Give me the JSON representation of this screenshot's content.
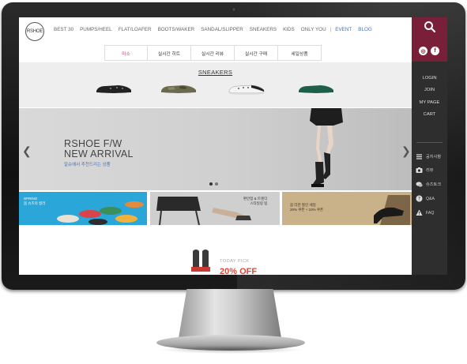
{
  "header": {
    "logo_text": "RSHOE",
    "nav": [
      "BEST 30",
      "PUMPS/HEEL",
      "FLAT/LOAFER",
      "BOOTS/WAKER",
      "SANDAL/SLIPPER",
      "SNEAKERS",
      "KIDS",
      "ONLY YOU"
    ],
    "nav_accent": [
      "EVENT",
      "BLOG"
    ],
    "separator": "|"
  },
  "subtabs": [
    "미소",
    "실시간 히트",
    "실시간 리뷰",
    "실시간 구매",
    "세일상품"
  ],
  "sneakers": {
    "title": "SNEAKERS"
  },
  "banner": {
    "title_line1": "RSHOE  F/W",
    "title_line2": "NEW ARRIVAL",
    "subtitle": "알슈에서 추천드리는 상품",
    "prev_arrow": "❮",
    "next_arrow": "❯"
  },
  "tiles": [
    {
      "label_line1": "SPRING",
      "label_line2": "봄 슈즈의 컬러"
    },
    {
      "label_line1": "편안함 & 트렌디",
      "label_line2": "스타일링 팁"
    },
    {
      "label_line1": "봄 더한 할인 세일",
      "label_line2": "20% 쿠폰 + 10% 쿠폰"
    }
  ],
  "today_pick": {
    "label": "TODAY PICK",
    "sale": "20% OFF"
  },
  "side": {
    "social": [
      "◎",
      "f"
    ],
    "links": [
      "LOGIN",
      "JOIN",
      "MY PAGE",
      "CART"
    ],
    "items": [
      {
        "icon": "list-icon",
        "label": "공지사항"
      },
      {
        "icon": "camera-icon",
        "label": "리뷰"
      },
      {
        "icon": "chat-icon",
        "label": "슈즈토크"
      },
      {
        "icon": "question-icon",
        "label": "Q&A"
      },
      {
        "icon": "warning-icon",
        "label": "FAQ"
      }
    ]
  },
  "colors": {
    "brand": "#7a1f3a",
    "accent": "#4a6fb5",
    "sale": "#e0483a",
    "side_bg": "#2e2e2e"
  }
}
